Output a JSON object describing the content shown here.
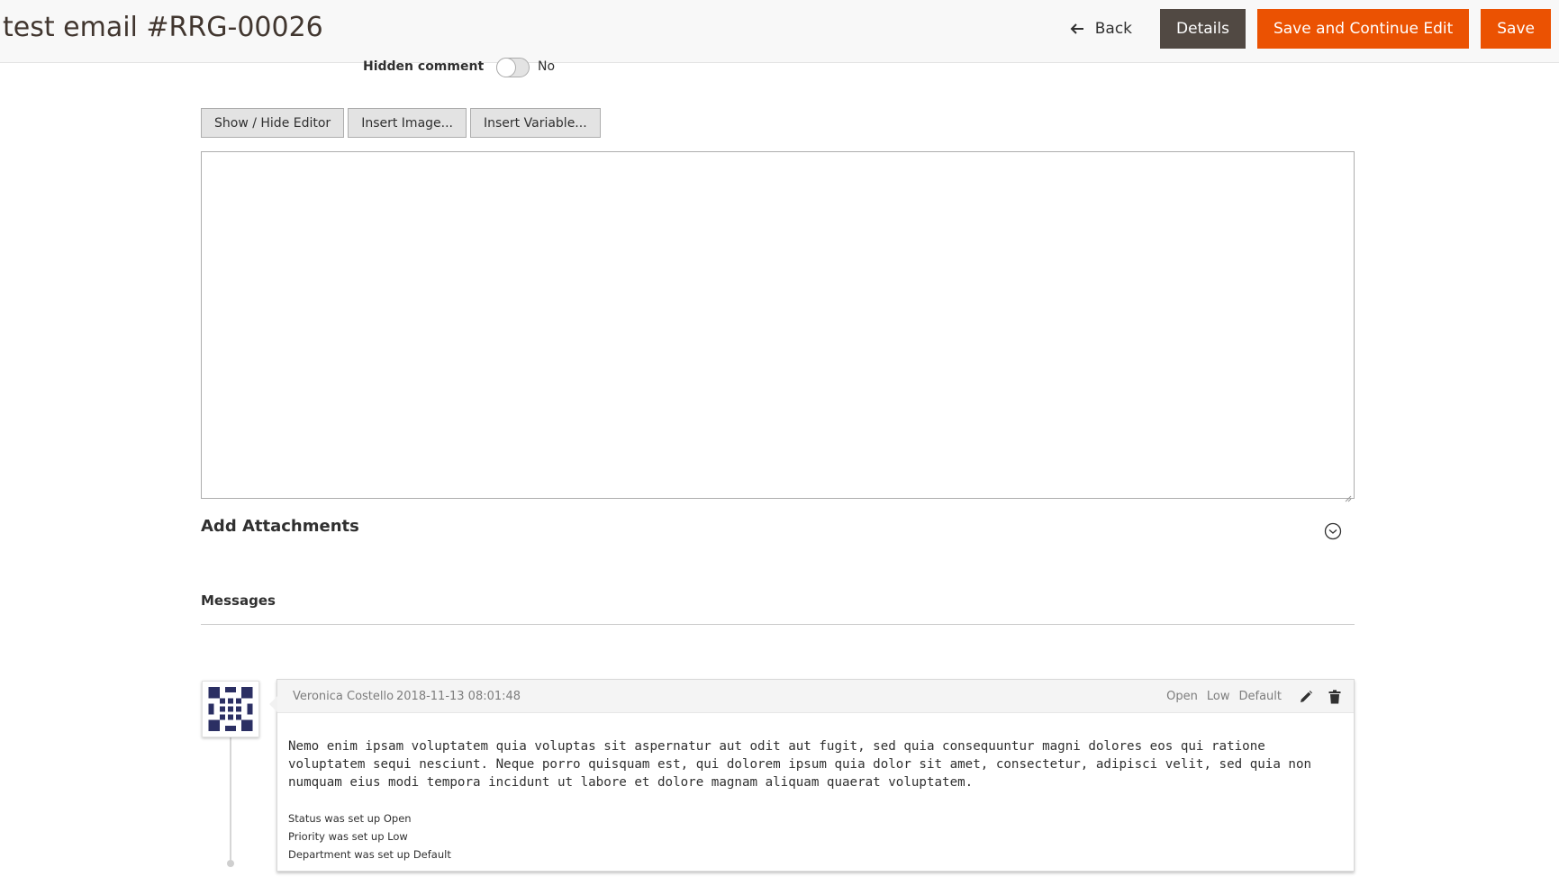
{
  "header": {
    "title": "test email #RRG-00026",
    "back_label": "Back",
    "details_label": "Details",
    "save_continue_label": "Save and Continue Edit",
    "save_label": "Save",
    "back_icon": "arrow-left-icon"
  },
  "hidden_comment": {
    "label": "Hidden comment",
    "state": "No",
    "enabled": false
  },
  "editor": {
    "buttons": [
      "Show / Hide Editor",
      "Insert Image...",
      "Insert Variable..."
    ],
    "content": ""
  },
  "attachments": {
    "title": "Add Attachments",
    "toggle_icon": "chevron-down-circle-icon"
  },
  "messages": {
    "title": "Messages",
    "items": [
      {
        "author": "Veronica Costello",
        "date": "2018-11-13 08:01:48",
        "status": "Open",
        "priority": "Low",
        "department": "Default",
        "body": "Nemo enim ipsam voluptatem quia voluptas sit aspernatur aut odit aut fugit, sed quia consequuntur magni dolores eos qui ratione voluptatem sequi nesciunt. Neque porro quisquam est, qui dolorem ipsum quia dolor sit amet, consectetur, adipisci velit, sed quia non numquam eius modi tempora incidunt ut labore et dolore magnam aliquam quaerat voluptatem.",
        "history": [
          "Status was set up Open",
          "Priority was set up Low",
          "Department was set up Default"
        ],
        "avatar_color": "#2b2f63"
      }
    ]
  },
  "colors": {
    "primary": "#eb5202",
    "secondary": "#514943",
    "avatar": "#2b2f63"
  }
}
